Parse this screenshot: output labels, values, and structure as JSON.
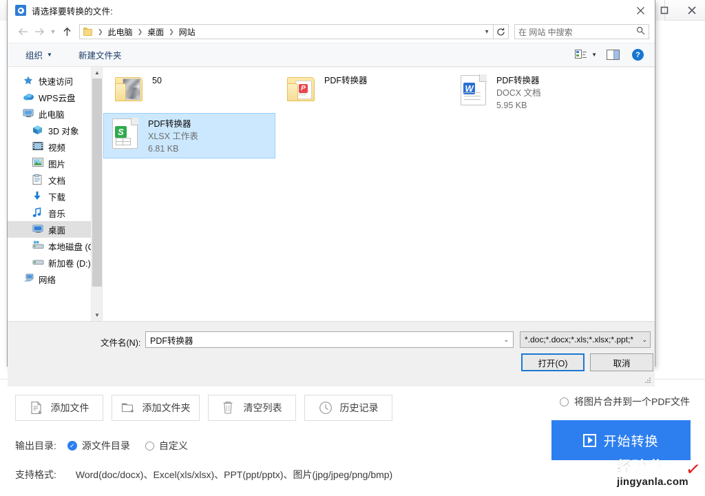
{
  "app_window": {
    "maximize_icon": "maximize-icon",
    "close_icon": "close-icon"
  },
  "dialog": {
    "title": "请选择要转换的文件:",
    "app_icon": "target-icon",
    "close_icon": "close-icon",
    "nav": {
      "back_icon": "arrow-left-icon",
      "forward_icon": "arrow-right-icon",
      "recent_icon": "chevron-down-icon",
      "up_icon": "arrow-up-icon",
      "folder_icon": "folder-icon",
      "breadcrumbs": [
        "此电脑",
        "桌面",
        "网站"
      ],
      "breadcrumb_caret": "chevron-down-icon",
      "refresh_icon": "refresh-icon",
      "search_placeholder": "在 网站 中搜索",
      "search_icon": "search-icon"
    },
    "command_bar": {
      "organize": "组织",
      "organize_caret": "chevron-down-icon",
      "new_folder": "新建文件夹",
      "view_icon": "view-options-icon",
      "view_caret": "chevron-down-icon",
      "preview_pane_icon": "preview-pane-icon",
      "help_icon": "help-icon",
      "help_label": "?"
    },
    "sidebar": {
      "items": [
        {
          "label": "快速访问",
          "icon": "star-icon",
          "indent": false,
          "selected": false
        },
        {
          "label": "WPS云盘",
          "icon": "cloud-icon",
          "indent": false,
          "selected": false
        },
        {
          "label": "此电脑",
          "icon": "computer-icon",
          "indent": false,
          "selected": false
        },
        {
          "label": "3D 对象",
          "icon": "cube-icon",
          "indent": true,
          "selected": false
        },
        {
          "label": "视频",
          "icon": "video-icon",
          "indent": true,
          "selected": false
        },
        {
          "label": "图片",
          "icon": "picture-icon",
          "indent": true,
          "selected": false
        },
        {
          "label": "文档",
          "icon": "document-icon",
          "indent": true,
          "selected": false
        },
        {
          "label": "下载",
          "icon": "download-icon",
          "indent": true,
          "selected": false
        },
        {
          "label": "音乐",
          "icon": "music-icon",
          "indent": true,
          "selected": false
        },
        {
          "label": "桌面",
          "icon": "desktop-icon",
          "indent": true,
          "selected": true
        },
        {
          "label": "本地磁盘 (C:)",
          "icon": "system-drive-icon",
          "indent": true,
          "selected": false
        },
        {
          "label": "新加卷 (D:)",
          "icon": "drive-icon",
          "indent": true,
          "selected": false
        },
        {
          "label": "网络",
          "icon": "network-icon",
          "indent": false,
          "selected": false
        }
      ],
      "scrollbar_up_icon": "chevron-up-icon",
      "scrollbar_down_icon": "chevron-down-icon"
    },
    "files": [
      {
        "name": "50",
        "type": "",
        "size": "",
        "icon": "folder-photo-icon",
        "selected": false
      },
      {
        "name": "PDF转换器",
        "type": "",
        "size": "",
        "icon": "folder-pdf-icon",
        "selected": false
      },
      {
        "name": "PDF转换器",
        "type": "DOCX 文档",
        "size": "5.95 KB",
        "icon": "word-file-icon",
        "selected": false
      },
      {
        "name": "PDF转换器",
        "type": "XLSX 工作表",
        "size": "6.81 KB",
        "icon": "excel-file-icon",
        "selected": true
      }
    ],
    "footer": {
      "filename_label": "文件名(N):",
      "filename_value": "PDF转换器",
      "filename_caret": "chevron-down-icon",
      "filter_value": "*.doc;*.docx;*.xls;*.xlsx;*.ppt;*",
      "filter_caret": "chevron-down-icon",
      "open_button": "打开(O)",
      "cancel_button": "取消"
    }
  },
  "bottom_panel": {
    "tools": [
      {
        "label": "添加文件",
        "icon": "add-file-icon"
      },
      {
        "label": "添加文件夹",
        "icon": "add-folder-icon"
      },
      {
        "label": "清空列表",
        "icon": "trash-icon"
      },
      {
        "label": "历史记录",
        "icon": "clock-icon"
      }
    ],
    "merge_option": {
      "label": "将图片合并到一个PDF文件",
      "icon": "radio-unchecked-icon",
      "selected": false
    },
    "convert_button": {
      "label": "开始转换",
      "icon": "play-icon",
      "color": "#2d7ff0"
    },
    "output": {
      "label": "输出目录:",
      "options": [
        {
          "label": "源文件目录",
          "selected": true,
          "icon": "radio-checked-icon"
        },
        {
          "label": "自定义",
          "selected": false,
          "icon": "radio-unchecked-icon"
        }
      ]
    },
    "formats": {
      "label": "支持格式:",
      "value": "Word(doc/docx)、Excel(xls/xlsx)、PPT(ppt/pptx)、图片(jpg/jpeg/png/bmp)"
    },
    "watermark": {
      "main": "经验啦",
      "check": "✓",
      "sub": "jingyanla.com",
      "check_color": "#e02020"
    }
  }
}
